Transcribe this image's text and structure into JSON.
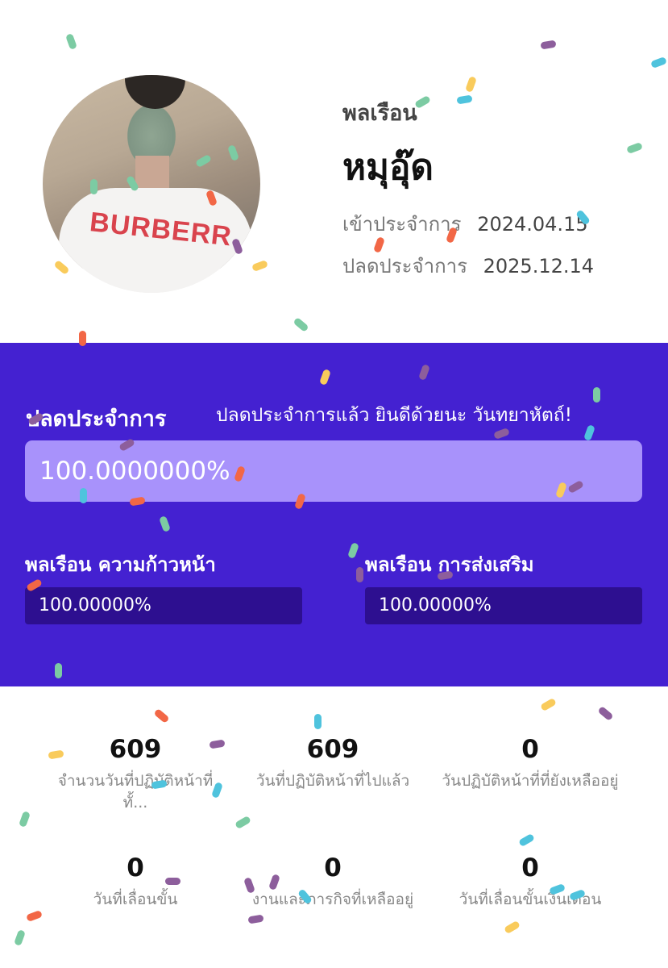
{
  "profile": {
    "rank": "พลเรือน",
    "name": "หมุอุ๊ด",
    "enlist_label": "เข้าประจำการ",
    "enlist_date": "2024.04.15",
    "discharge_label": "ปลดประจำการ",
    "discharge_date": "2025.12.14",
    "avatar_shirt_text": "BURBERR"
  },
  "progress": {
    "title": "ปลดประจำการ",
    "message": "ปลดประจำการแล้ว ยินดีด้วยนะ วันทยาหัตถ์!",
    "main_value_text": "100.0000000%",
    "main_fraction": 1.0,
    "sub_items": [
      {
        "label": "พลเรือน ความก้าวหน้า",
        "value_text": "100.00000%"
      },
      {
        "label": "พลเรือน การส่งเสริม",
        "value_text": "100.00000%"
      }
    ]
  },
  "stats": [
    {
      "value": "609",
      "label": "จำนวนวันที่ปฏิบัติหน้าที่ทั้..."
    },
    {
      "value": "609",
      "label": "วันที่ปฏิบัติหน้าที่ไปแล้ว"
    },
    {
      "value": "0",
      "label": "วันปฏิบัติหน้าที่ที่ยังเหลืออยู่"
    },
    {
      "value": "0",
      "label": "วันที่เลื่อนขั้น"
    },
    {
      "value": "0",
      "label": "งานและภารกิจที่เหลืออยู่"
    },
    {
      "value": "0",
      "label": "วันที่เลื่อนขั้นเงินเดือน"
    }
  ],
  "colors": {
    "panel": "#4421d1",
    "bar_fill": "#a892fb",
    "sub_bar": "#2d0f90",
    "confetti": [
      "#7ccba3",
      "#8d5e9c",
      "#f9cb5c",
      "#f26746",
      "#4fc3dd"
    ]
  }
}
